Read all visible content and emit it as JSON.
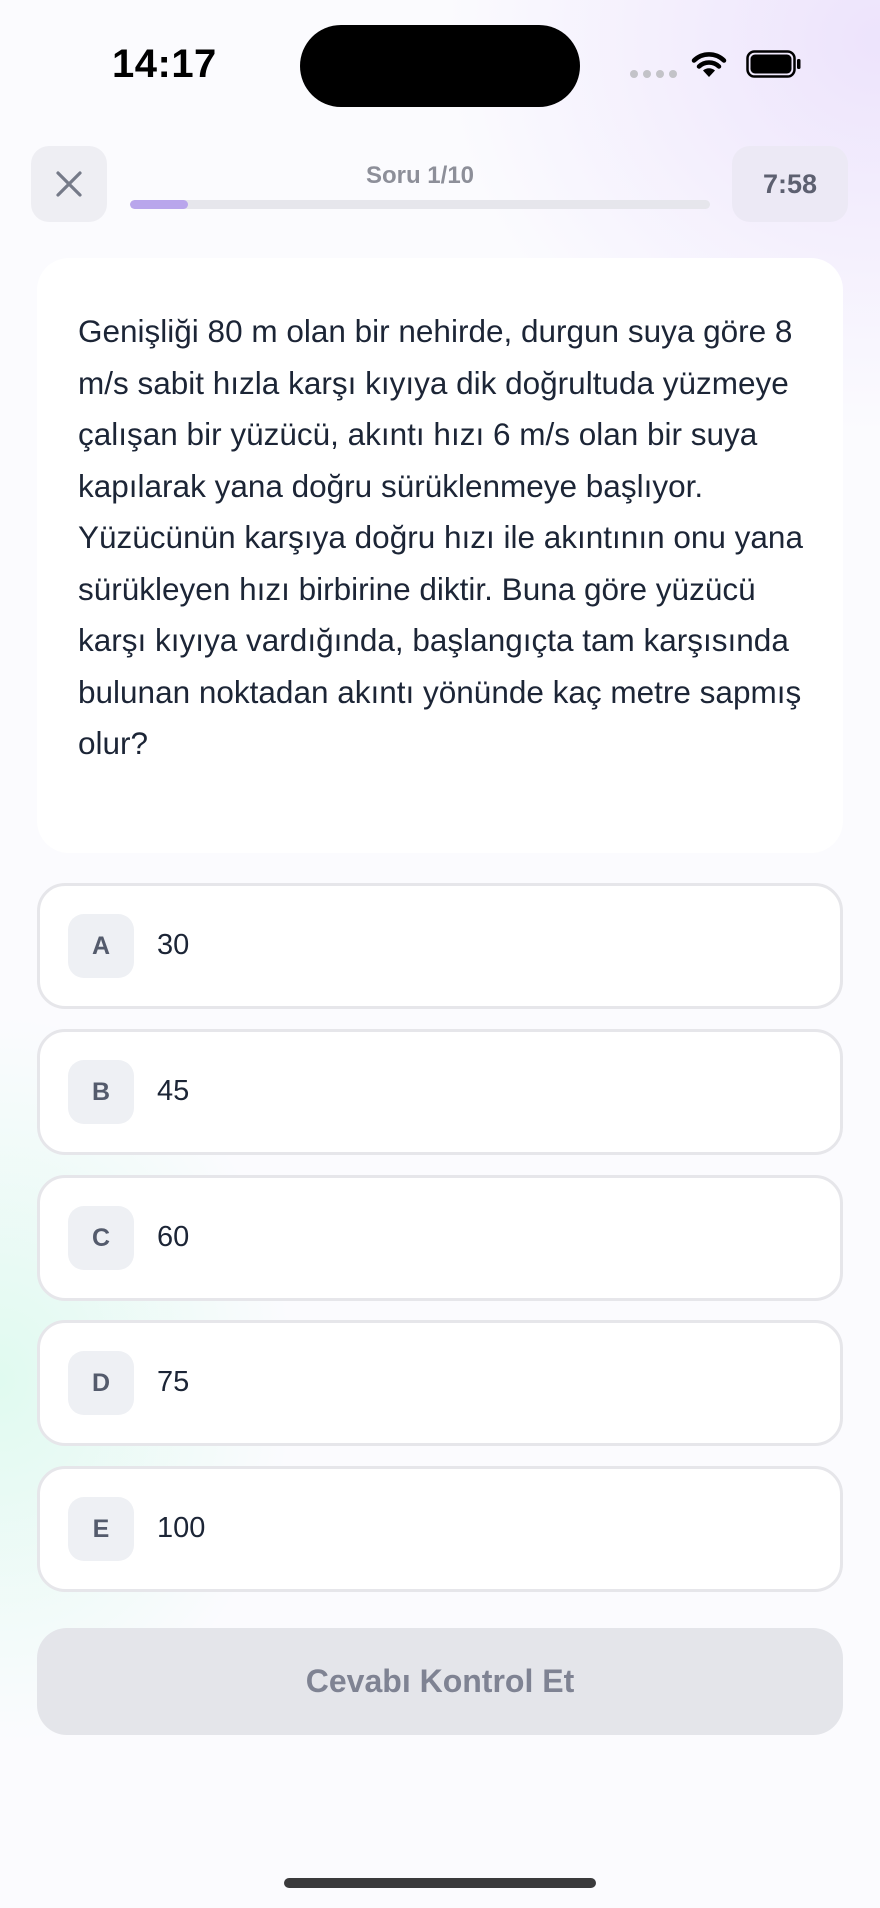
{
  "status_bar": {
    "time": "14:17",
    "icons": [
      "cellular-signal-icon",
      "wifi-icon",
      "battery-icon"
    ]
  },
  "header": {
    "close_icon": "close-icon",
    "progress_label": "Soru 1/10",
    "progress_fraction": 0.1,
    "timer": "7:58"
  },
  "question": {
    "text": "Genişliği 80 m olan bir nehirde, durgun suya göre 8 m/s sabit hızla karşı kıyıya dik doğrultuda yüzmeye çalışan bir yüzücü, akıntı hızı 6 m/s olan bir suya kapılarak yana doğru sürüklenmeye başlıyor. Yüzücünün karşıya doğru hızı ile akıntının onu yana sürükleyen hızı birbirine diktir. Buna göre yüzücü karşı kıyıya vardığında, başlangıçta tam karşısında bulunan noktadan akıntı yönünde kaç metre sapmış olur?"
  },
  "options": [
    {
      "letter": "A",
      "value": "30"
    },
    {
      "letter": "B",
      "value": "45"
    },
    {
      "letter": "C",
      "value": "60"
    },
    {
      "letter": "D",
      "value": "75"
    },
    {
      "letter": "E",
      "value": "100"
    }
  ],
  "actions": {
    "check_label": "Cevabı Kontrol Et"
  },
  "colors": {
    "text_primary": "#1c2536",
    "progress_fill": "#b9a6ec",
    "button_disabled_bg": "#e4e5ea",
    "button_disabled_text": "#7f8393"
  }
}
